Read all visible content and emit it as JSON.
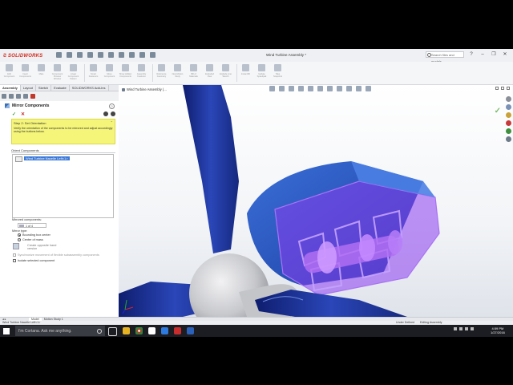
{
  "window": {
    "app_name": "SOLIDWORKS",
    "title": "Wind Turbine Assembly *",
    "search_placeholder": "Search files and models"
  },
  "command_manager": [
    {
      "label": "Edit Component"
    },
    {
      "label": "Insert Components"
    },
    {
      "label": "Mate"
    },
    {
      "label": "Component Preview Window"
    },
    {
      "label": "Linear Component Pattern"
    },
    {
      "label": "Smart Fasteners"
    },
    {
      "label": "Move Component"
    },
    {
      "label": "Show Hidden Components"
    },
    {
      "label": "Assembly Features"
    },
    {
      "label": "Reference Geometry"
    },
    {
      "label": "New Motion Study"
    },
    {
      "label": "Bill of Materials"
    },
    {
      "label": "Exploded View"
    },
    {
      "label": "Explode Line Sketch"
    },
    {
      "label": "Instant3D"
    },
    {
      "label": "Update Speedpak"
    },
    {
      "label": "Take Snapshot"
    }
  ],
  "tabs": [
    "Assembly",
    "Layout",
    "Sketch",
    "Evaluate",
    "SOLIDWORKS Add-Ins"
  ],
  "property_manager": {
    "title": "Mirror Components",
    "help": "?",
    "ok_symbol": "✓",
    "cancel_symbol": "✕",
    "step_heading": "Step 2: Set Orientation",
    "step_text": "Verify the orientation of the components to be mirrored and adjust accordingly using the buttons below.",
    "oriented_heading": "Orient Components",
    "oriented_item": "Wind Turbine Nacelle Left<1>",
    "mirrored_label": "Mirrored components:",
    "spin_value": "1 of 4",
    "mirror_type_label": "Mirror type:",
    "radio_bounding": "Bounding box center",
    "radio_mass": "Center of mass",
    "create_opposite": "Create opposite hand version",
    "sync_label": "Synchronize movement of flexible subassembly components",
    "isolate_label": "Isolate selected component"
  },
  "viewport": {
    "breadcrumb": "Wind Turbine Assembly  (..."
  },
  "bottom_tabs": [
    "Model",
    "Motion Study 1"
  ],
  "status": {
    "left": "Wind Turbine Nacelle Left<1>",
    "under_defined": "Under Defined",
    "editing": "Editing Assembly"
  },
  "taskbar": {
    "cortana": "I'm Cortana. Ask me anything.",
    "time": "4:59 PM",
    "date": "1/27/2016"
  },
  "colors": {
    "blade": "#1a2f8c",
    "hub": "#c8c9cd",
    "nacelle_transparent": "#8a3df0",
    "accent_selected": "#3b78d8",
    "step_box": "#f5f57a"
  }
}
